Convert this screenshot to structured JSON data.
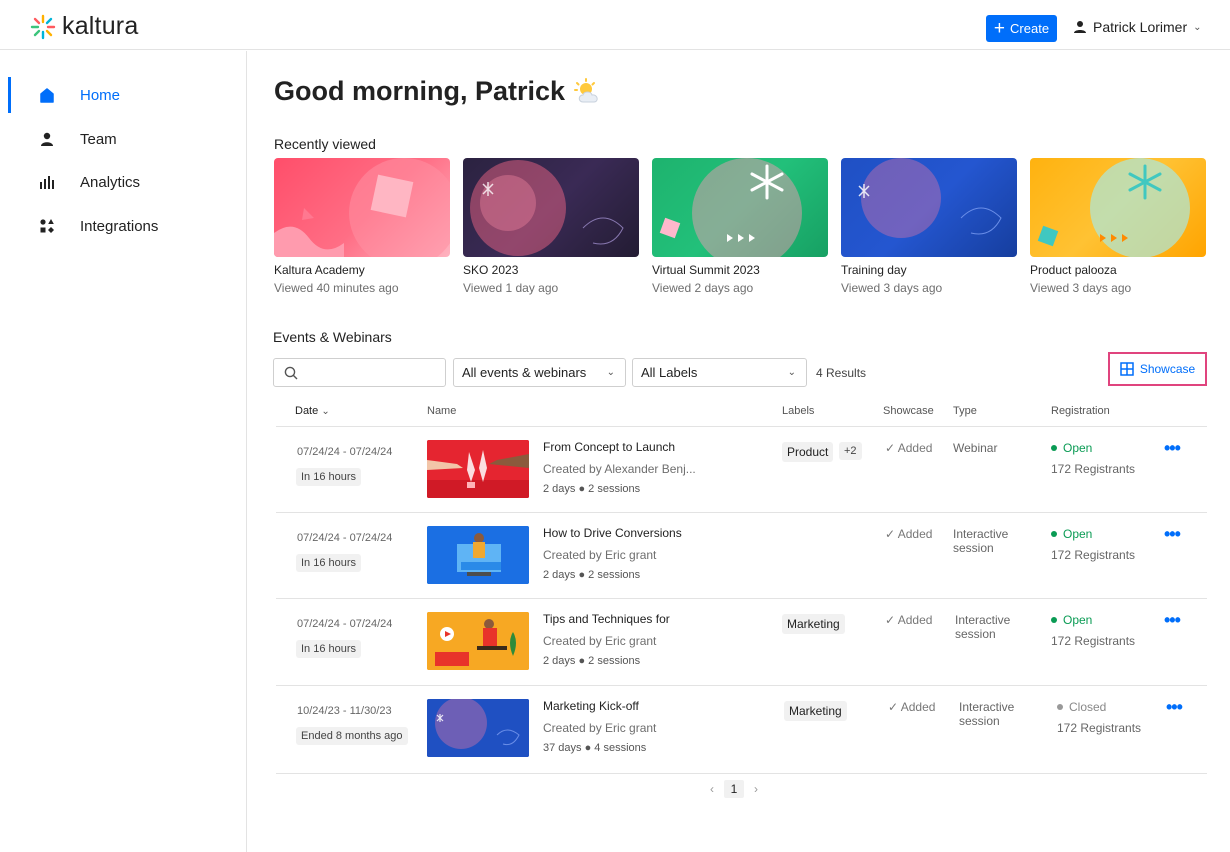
{
  "header": {
    "logo_text": "kaltura",
    "create_label": "Create",
    "user_name": "Patrick Lorimer"
  },
  "sidebar": {
    "items": [
      {
        "label": "Home",
        "icon": "home-icon",
        "active": true
      },
      {
        "label": "Team",
        "icon": "user-icon"
      },
      {
        "label": "Analytics",
        "icon": "bar-chart-icon"
      },
      {
        "label": "Integrations",
        "icon": "integrations-icon"
      }
    ]
  },
  "main": {
    "greeting": "Good morning, Patrick",
    "recently_viewed_title": "Recently viewed",
    "recently_viewed": [
      {
        "title": "Kaltura Academy",
        "viewed": "Viewed 40 minutes ago"
      },
      {
        "title": "SKO 2023",
        "viewed": "Viewed 1 day ago"
      },
      {
        "title": "Virtual Summit 2023",
        "viewed": "Viewed 2 days ago"
      },
      {
        "title": "Training day",
        "viewed": "Viewed 3 days ago"
      },
      {
        "title": "Product palooza",
        "viewed": "Viewed 3 days ago"
      }
    ],
    "events_title": "Events & Webinars",
    "filters": {
      "search_placeholder": "",
      "type_select": "All events & webinars",
      "labels_select": "All Labels",
      "results": "4 Results",
      "showcase_label": "Showcase"
    },
    "table": {
      "headers": {
        "date": "Date",
        "name": "Name",
        "labels": "Labels",
        "showcase": "Showcase",
        "type": "Type",
        "registration": "Registration"
      },
      "rows": [
        {
          "date_range": "07/24/24 - 07/24/24",
          "when": "In 16 hours",
          "name": "From Concept to Launch",
          "creator": "Created by Alexander Benj...",
          "meta": "2 days ● 2 sessions",
          "label": "Product",
          "label_more": "+2",
          "showcase": "✓ Added",
          "type": "Webinar",
          "status": "Open",
          "registrants": "172 Registrants"
        },
        {
          "date_range": "07/24/24 - 07/24/24",
          "when": "In 16 hours",
          "name": "How to Drive Conversions",
          "creator": "Created by Eric grant",
          "meta": "2 days ● 2 sessions",
          "label": "",
          "label_more": "",
          "showcase": "✓ Added",
          "type": "Interactive session",
          "status": "Open",
          "registrants": "172 Registrants"
        },
        {
          "date_range": "07/24/24 - 07/24/24",
          "when": "In 16 hours",
          "name": "Tips and Techniques for",
          "creator": "Created by Eric grant",
          "meta": "2 days ● 2 sessions",
          "label": "Marketing",
          "label_more": "",
          "showcase": "✓ Added",
          "type": "Interactive session",
          "status": "Open",
          "registrants": "172 Registrants"
        },
        {
          "date_range": "10/24/23 - 11/30/23",
          "when": "Ended 8 months ago",
          "name": "Marketing Kick-off",
          "creator": "Created by Eric grant",
          "meta": "37 days ● 4 sessions",
          "label": "Marketing",
          "label_more": "",
          "showcase": "✓ Added",
          "type": "Interactive session",
          "status": "Closed",
          "registrants": "172 Registrants"
        }
      ]
    },
    "pagination": {
      "current": "1",
      "prev": "‹",
      "next": "›"
    }
  },
  "colors": {
    "accent": "#006efa",
    "open": "#0a9b54",
    "closed": "#999999",
    "highlight": "#e0447e"
  }
}
